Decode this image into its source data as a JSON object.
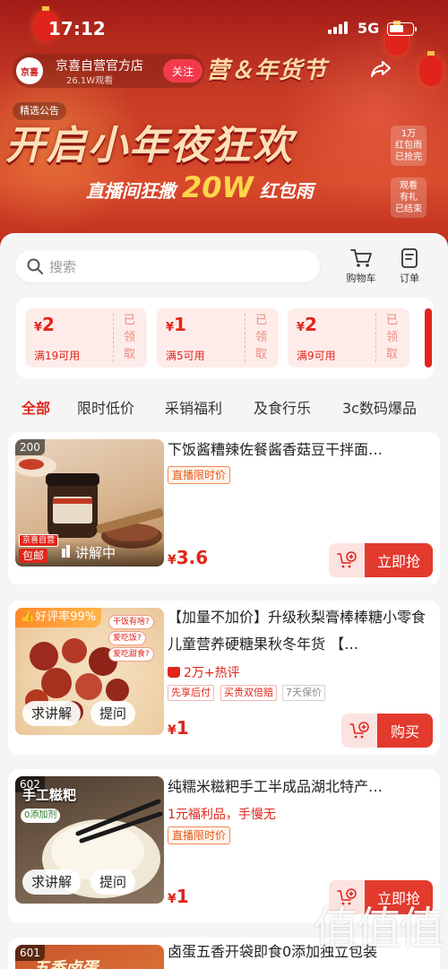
{
  "status_bar": {
    "time": "17:12",
    "network": "5G"
  },
  "live": {
    "anchor_name": "京喜自营官方店",
    "viewer_count": "26.1W观看",
    "avatar_text": "京喜",
    "follow_label": "关注",
    "banner_subtitle": "营＆年货节",
    "notice_label": "精选公告",
    "headline": "开启小年夜狂欢",
    "red_packet_prefix": "直播间狂撒",
    "red_packet_amount": "20W",
    "red_packet_suffix": "红包雨",
    "side_card_1": [
      "1万",
      "红包雨",
      "已抢完"
    ],
    "side_card_2": [
      "观看",
      "有礼",
      "已结束"
    ]
  },
  "sheet": {
    "search_placeholder": "搜索",
    "cart_label": "购物车",
    "orders_label": "订单",
    "coupons": [
      {
        "amount": "2",
        "condition": "满19可用",
        "status": "已领取"
      },
      {
        "amount": "1",
        "condition": "满5可用",
        "status": "已领取"
      },
      {
        "amount": "2",
        "condition": "满9可用",
        "status": "已领取"
      }
    ],
    "tabs": [
      "全部",
      "限时低价",
      "采销福利",
      "及食行乐",
      "3c数码爆品"
    ],
    "products": [
      {
        "rank": "200",
        "title": "下饭酱糟辣佐餐酱香菇豆干拌面…",
        "badge": "直播限时价",
        "price_symbol": "¥",
        "price": "3.6",
        "thumb_tag": "京喜自营",
        "thumb_tag2": "包邮",
        "live_status": "讲解中",
        "buy_label": "立即抢"
      },
      {
        "rank_badge": "好评率99%",
        "title": "【加量不加价】升级秋梨膏棒棒糖小零食儿童营养硬糖果秋冬年货 【…",
        "reviews": "2万+热评",
        "tags": [
          "先享后付",
          "买贵双倍赔",
          "7天保价"
        ],
        "price_symbol": "¥",
        "price": "1",
        "ask_explain": "求讲解",
        "ask_question": "提问",
        "thumb_bubbles": [
          "干饭有啥?",
          "爱吃饭?",
          "爱吃甜食?"
        ],
        "buy_label": "购买"
      },
      {
        "rank": "602",
        "thumb_title": "手工糍粑",
        "thumb_chip": "0添加剂",
        "title": "纯糯米糍粑手工半成品湖北特产…",
        "subtitle": "1元福利品，手慢无",
        "badge": "直播限时价",
        "price_symbol": "¥",
        "price": "1",
        "ask_explain": "求讲解",
        "ask_question": "提问",
        "buy_label": "立即抢"
      },
      {
        "rank": "601",
        "thumb_title": "五香卤蛋",
        "title": "卤蛋五香开袋即食0添加独立包装"
      }
    ]
  },
  "watermark": "值值值"
}
